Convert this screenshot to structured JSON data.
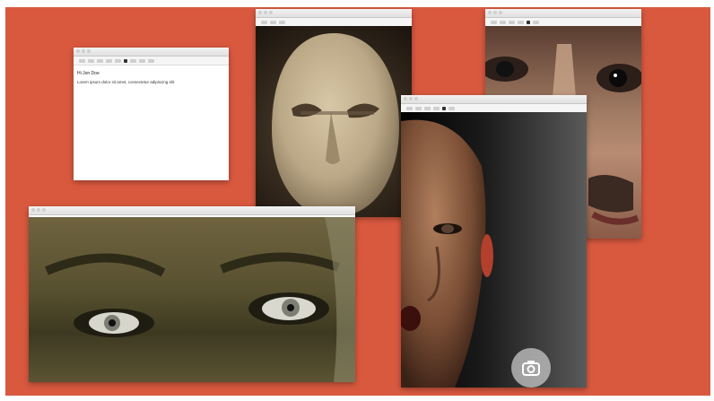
{
  "editor": {
    "title_line": "Hi Jon Doe",
    "body_line": "Lorem ipsum dolor sit amet, consectetur adipiscing elit"
  },
  "windows": {
    "stone_title": "",
    "closeup_title": "",
    "eyes_title": "",
    "head_title": ""
  },
  "colors": {
    "desktop_background": "#d9593f"
  },
  "icons": {
    "camera": "camera-switch-icon"
  }
}
